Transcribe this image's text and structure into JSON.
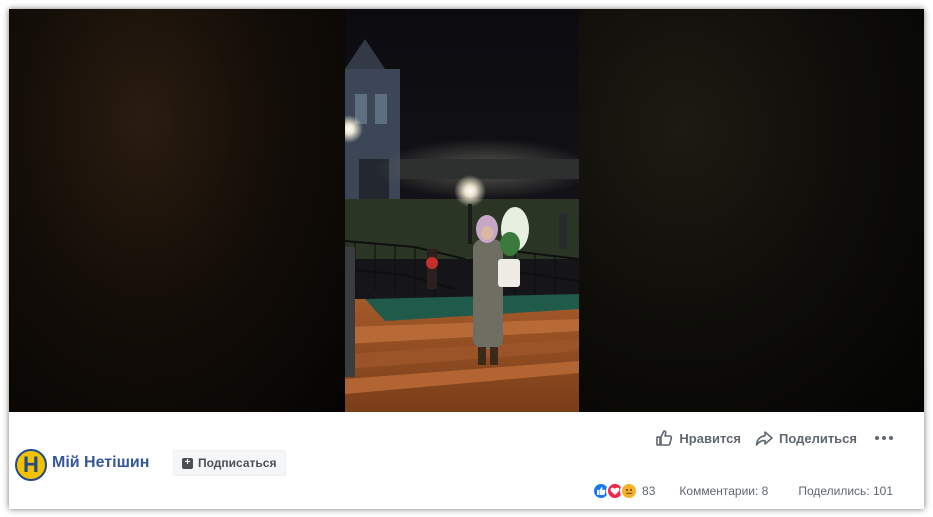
{
  "page": {
    "name": "Мій Нетішин",
    "logo_letter": "Н"
  },
  "subscribe": {
    "label": "Подписаться"
  },
  "actions": {
    "like_label": "Нравится",
    "share_label": "Поделиться"
  },
  "stats": {
    "reactions_count": "83",
    "comments_label": "Комментарии: 8",
    "shares_label": "Поделились: 101"
  },
  "colors": {
    "brand_link": "#365899",
    "logo_bg": "#f2c200",
    "logo_fg": "#234a8a",
    "like_blue": "#1877f2",
    "love_red": "#f02849",
    "sad_yellow": "#f7b125"
  },
  "icons": {
    "like": "thumbs-up-icon",
    "share": "share-arrow-icon",
    "more": "more-dots-icon",
    "subscribe": "plus-box-icon"
  }
}
